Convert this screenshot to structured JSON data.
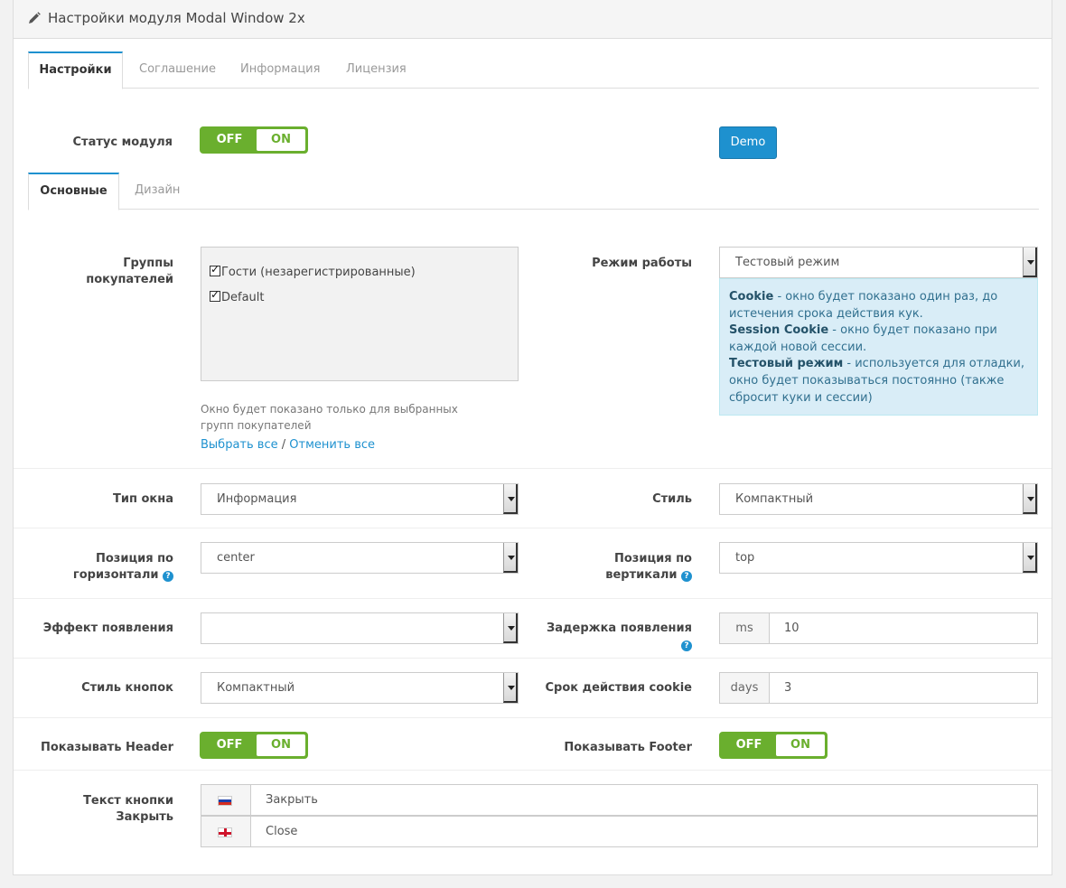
{
  "header": {
    "title": "Настройки модуля Modal Window 2x",
    "icon": "pencil-icon"
  },
  "tabs": [
    {
      "label": "Настройки",
      "active": true
    },
    {
      "label": "Соглашение",
      "active": false
    },
    {
      "label": "Информация",
      "active": false
    },
    {
      "label": "Лицензия",
      "active": false
    }
  ],
  "status": {
    "label": "Статус модуля",
    "off": "OFF",
    "on": "ON",
    "value": "off"
  },
  "demo_button": "Demo",
  "subtabs": [
    {
      "label": "Основные",
      "active": true
    },
    {
      "label": "Дизайн",
      "active": false
    }
  ],
  "groups": {
    "label": "Группы покупателей",
    "items": [
      {
        "label": "Гости (незарегистрированные)",
        "checked": true
      },
      {
        "label": "Default",
        "checked": true
      }
    ],
    "help": "Окно будет показано только для выбранных групп покупателей",
    "select_all": "Выбрать все",
    "link_sep": "/",
    "deselect_all": "Отменить все"
  },
  "mode": {
    "label": "Режим работы",
    "value": "Тестовый режим",
    "info": [
      {
        "term": "Cookie",
        "text": " - окно будет показано один раз, до истечения срока действия кук."
      },
      {
        "term": "Session Cookie",
        "text": " - окно будет показано при каждой новой сессии."
      },
      {
        "term": "Тестовый режим",
        "text": " - используется для отладки, окно будет показываться постоянно (также сбросит куки и сессии)"
      }
    ]
  },
  "window_type": {
    "label": "Тип окна",
    "value": "Информация"
  },
  "style": {
    "label": "Стиль",
    "value": "Компактный"
  },
  "pos_h": {
    "label_line1": "Позиция по",
    "label_line2": "горизонтали",
    "value": "center"
  },
  "pos_v": {
    "label_line1": "Позиция по",
    "label_line2": "вертикали",
    "value": "top"
  },
  "effect": {
    "label": "Эффект появления",
    "value": ""
  },
  "delay": {
    "label": "Задержка появления",
    "unit": "ms",
    "value": "10"
  },
  "button_style": {
    "label": "Стиль кнопок",
    "value": "Компактный"
  },
  "cookie_expiry": {
    "label": "Срок действия cookie",
    "unit": "days",
    "value": "3"
  },
  "show_header": {
    "label": "Показывать Header",
    "off": "OFF",
    "on": "ON"
  },
  "show_footer": {
    "label": "Показывать Footer",
    "off": "OFF",
    "on": "ON"
  },
  "close_text": {
    "label": "Текст кнопки Закрыть",
    "ru": "Закрыть",
    "en": "Close"
  },
  "help_icon": "?",
  "colors": {
    "accent": "#1e91cf",
    "toggle": "#6aaf2e",
    "info_bg": "#d9edf7"
  }
}
